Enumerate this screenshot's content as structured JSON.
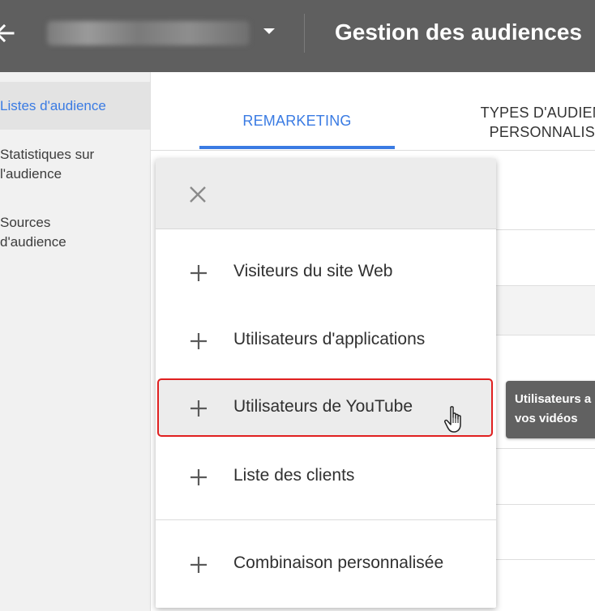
{
  "header": {
    "account_name": "Plan - Nom 01234",
    "title": "Gestion des audiences"
  },
  "sidebar": {
    "items": [
      {
        "label": "Listes d'audience"
      },
      {
        "label_line1": "Statistiques sur",
        "label_line2": "l'audience"
      },
      {
        "label_line1": "Sources",
        "label_line2": "d'audience"
      }
    ]
  },
  "tabs": [
    {
      "label": "REMARKETING"
    },
    {
      "label_line1": "TYPES D'AUDIENCE",
      "label_line2": "PERSONNALISÉS"
    }
  ],
  "menu": {
    "items": [
      {
        "label": "Visiteurs du site Web"
      },
      {
        "label": "Utilisateurs d'applications"
      },
      {
        "label": "Utilisateurs de YouTube"
      },
      {
        "label": "Liste des clients"
      },
      {
        "label": "Combinaison personnalisée"
      }
    ]
  },
  "tooltip": {
    "line1": "Utilisateurs a",
    "line2": "vos vidéos"
  },
  "colors": {
    "header_bg": "#5f5f5f",
    "accent": "#3a7be3",
    "highlight_border": "#e02020",
    "tooltip_bg": "#616161"
  }
}
